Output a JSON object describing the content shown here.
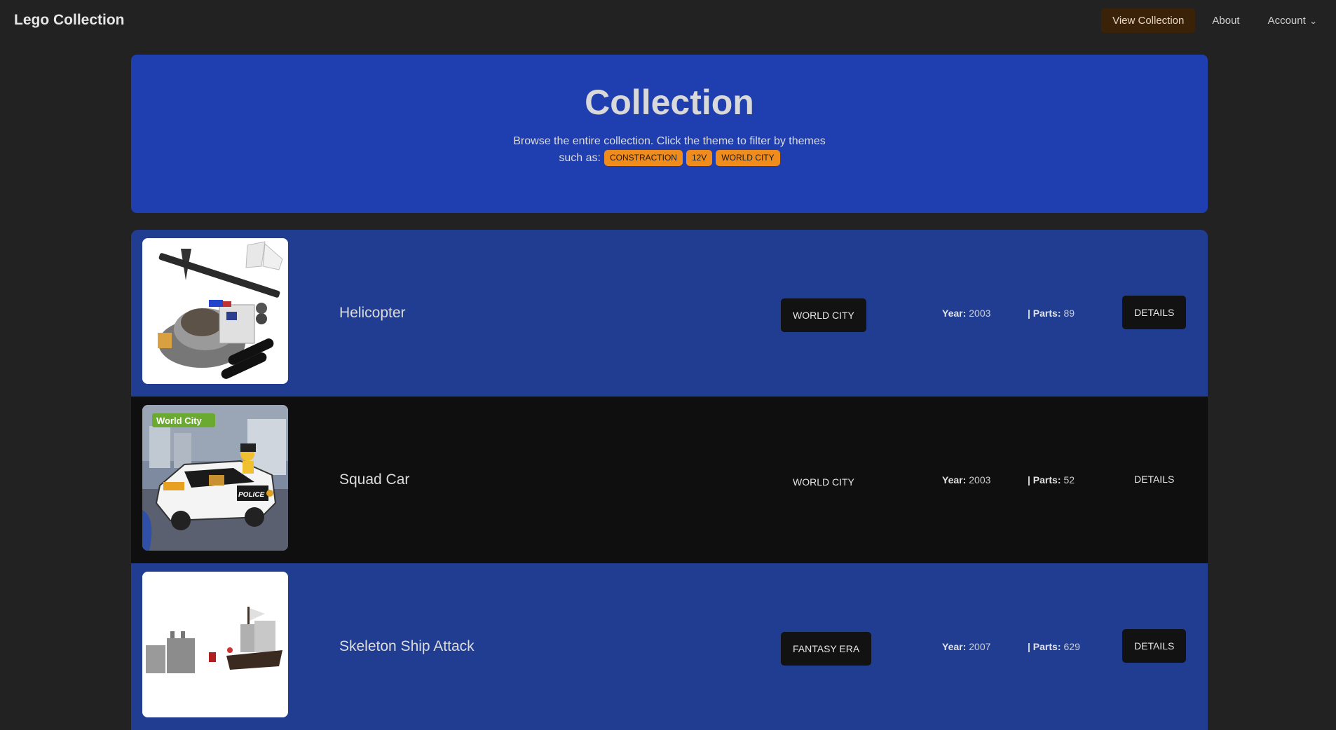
{
  "nav": {
    "brand": "Lego Collection",
    "links": [
      "View Collection",
      "About",
      "Account"
    ]
  },
  "hero": {
    "title": "Collection",
    "desc_line1": "Browse the entire collection. Click the theme to filter by themes",
    "desc_line2": "such as:",
    "themes": [
      "CONSTRACTION",
      "12V",
      "WORLD CITY"
    ]
  },
  "sets": [
    {
      "name": "Helicopter",
      "theme": "WORLD CITY",
      "year_label": "Year:",
      "year": "2003",
      "parts_label": "| Parts:",
      "parts": "89",
      "details": "DETAILS",
      "image_icon": "helicopter-set-image"
    },
    {
      "name": "Squad Car",
      "theme": "WORLD CITY",
      "year_label": "Year:",
      "year": "2003",
      "parts_label": "| Parts:",
      "parts": "52",
      "details": "DETAILS",
      "image_icon": "squad-car-set-image",
      "box_label": "World City",
      "car_label": "POLICE"
    },
    {
      "name": "Skeleton Ship Attack",
      "theme": "FANTASY ERA",
      "year_label": "Year:",
      "year": "2007",
      "parts_label": "| Parts:",
      "parts": "629",
      "details": "DETAILS",
      "image_icon": "skeleton-ship-set-image"
    }
  ],
  "colors": {
    "hero": "#1f3eaf",
    "row_blue": "#203d92",
    "row_dark": "#0f0f0f",
    "badge": "#f08c1c",
    "bg": "#222222"
  }
}
